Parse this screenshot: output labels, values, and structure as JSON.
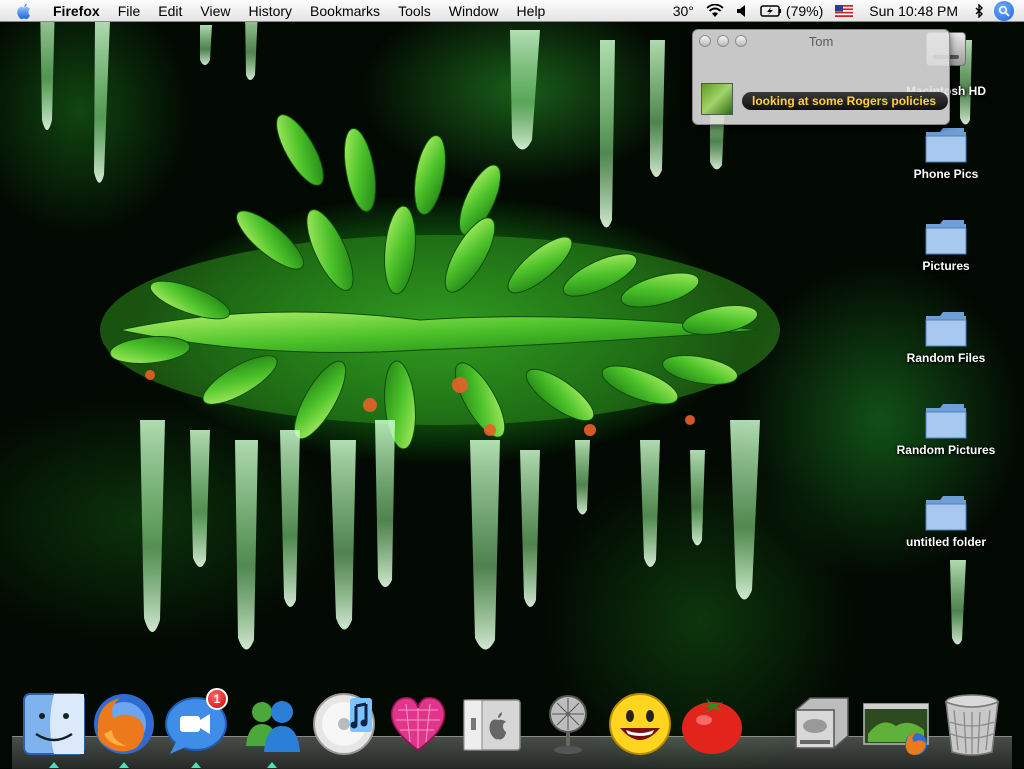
{
  "menubar": {
    "app_name": "Firefox",
    "menus": [
      "File",
      "Edit",
      "View",
      "History",
      "Bookmarks",
      "Tools",
      "Window",
      "Help"
    ],
    "temperature": "30°",
    "battery": "(79%)",
    "clock": "Sun 10:48 PM",
    "input_flag": "us-flag-icon"
  },
  "notification": {
    "title": "Tom",
    "message": "looking at some Rogers policies"
  },
  "desktop_icons": [
    {
      "label": "Macintosh HD",
      "icon": "hard-drive-icon"
    },
    {
      "label": "Phone Pics",
      "icon": "folder-icon"
    },
    {
      "label": "Pictures",
      "icon": "folder-icon"
    },
    {
      "label": "Random Files",
      "icon": "folder-icon"
    },
    {
      "label": "Random Pictures",
      "icon": "folder-icon"
    },
    {
      "label": "untitled folder",
      "icon": "folder-icon"
    }
  ],
  "dock": [
    {
      "name": "finder-icon",
      "running": true
    },
    {
      "name": "firefox-icon",
      "running": true
    },
    {
      "name": "ichat-icon",
      "running": true,
      "badge": "1"
    },
    {
      "name": "msn-messenger-icon",
      "running": true
    },
    {
      "name": "itunes-icon",
      "running": false
    },
    {
      "name": "pink-heart-icon",
      "running": false
    },
    {
      "name": "boot-camp-icon",
      "running": false
    },
    {
      "name": "fan-icon",
      "running": false
    },
    {
      "name": "yahoo-messenger-icon",
      "running": false
    },
    {
      "name": "tomato-icon",
      "running": false
    },
    {
      "name": "hard-drive-icon",
      "running": false
    },
    {
      "name": "firefox-download-window-icon",
      "running": false
    },
    {
      "name": "trash-icon",
      "running": false
    }
  ],
  "colors": {
    "menubar_bg": "#ececec",
    "notification_text": "#ffd13d",
    "folder_blue": "#7aa8e0"
  }
}
